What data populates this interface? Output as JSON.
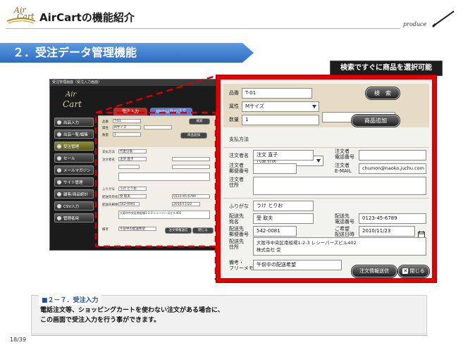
{
  "header": {
    "logo_line1": "Air",
    "logo_line2": "Cart",
    "title": "AirCartの機能紹介",
    "signature": "produce"
  },
  "banner": {
    "title": "２．受注データ管理機能"
  },
  "callout": {
    "text": "検索ですぐに商品を選択可能"
  },
  "small_screen": {
    "window_title": "受注管理画面（受注入力画面）",
    "logo1": "Air",
    "logo2": "Cart",
    "sidebar": [
      "出品入力",
      "出品一覧/編集",
      "受注管理",
      "セール",
      "メールマガジン",
      "サイト管理",
      "顧客/商品統計",
      "CSV入力",
      "管理者用"
    ],
    "tabs": [
      "受注入力",
      "Web以外の注文"
    ],
    "lines": [
      {
        "label": "品番",
        "value": "T-01"
      },
      {
        "label": "属性",
        "value": "Mサイズ"
      },
      {
        "label": "数量",
        "value": "1"
      },
      {
        "label": "支払方法",
        "value": "代金引換"
      },
      {
        "label": "注文者名",
        "value": "注文 直子"
      },
      {
        "label": "ふりがな",
        "value": "うけ とりお"
      },
      {
        "label": "配送先宛名",
        "value": "受 取夫"
      },
      {
        "label": "配送先郵便番号",
        "value": "542-0081"
      },
      {
        "label": "配送先住所",
        "value": "大阪市中央区南船場1-2-3 レシーバーズビル402"
      },
      {
        "label": "備考",
        "value": "午前中の配送希望"
      }
    ],
    "buttons": {
      "search": "検索",
      "add": "商品追加",
      "submit": "注文情報送信",
      "close": "閉じる"
    }
  },
  "form": {
    "hinban_label": "品番",
    "hinban_value": "T-01",
    "zokusei_label": "属性",
    "zokusei_value": "Mサイズ",
    "zokusei2_value": "",
    "suuryou_label": "数量",
    "suuryou_value": "1",
    "search_button": "検　索",
    "add_button": "商品追加",
    "payment_label": "支払方法",
    "payment_value": "代金引換",
    "orderer_name_label": "注文者名",
    "orderer_name_value": "注文 直子",
    "orderer_tel_label": "注文者\n電話番号",
    "orderer_tel_value": "",
    "orderer_zip_label": "注文者\n郵便番号",
    "orderer_zip_value": "",
    "orderer_email_label": "注文者\nE-MAIL",
    "orderer_email_value": "chumon@naoko.juchu.com",
    "orderer_addr_label": "注文者\n住所",
    "orderer_addr_value": "",
    "furigana_label": "ふりがな",
    "furigana_value": "うけ とりお",
    "ship_name_label": "配送先\n宛名",
    "ship_name_value": "受 取夫",
    "ship_tel_label": "配送先\n電話番号",
    "ship_tel_value": "0123-45-6789",
    "ship_zip_label": "配送先\n郵便番号",
    "ship_zip_value": "542-0081",
    "delivery_date_label": "ご希望\n配送日時",
    "delivery_date_value": "2010/11/23",
    "ship_addr_label": "配送先\n住所",
    "ship_addr_value_line1": "大阪市中央区南船場1-2-3 レシーバーズビル402",
    "ship_addr_value_line2": "株式会社 受",
    "memo_label": "備考・\nフリーメモ",
    "memo_value": "午前中の配送希望",
    "submit_button": "注文情報送信",
    "close_button": "閉じる"
  },
  "section": {
    "label": "■２－７．受注入力",
    "description_line1": "電話注文等、ショッピングカートを使わない注文がある場合に、",
    "description_line2": "この画面で受注入力を行う事ができます。"
  },
  "footer": {
    "page": "18/39"
  },
  "colors": {
    "banner": "#3a7bd0",
    "highlight": "#e00000",
    "section_label": "#1f4f9a"
  }
}
